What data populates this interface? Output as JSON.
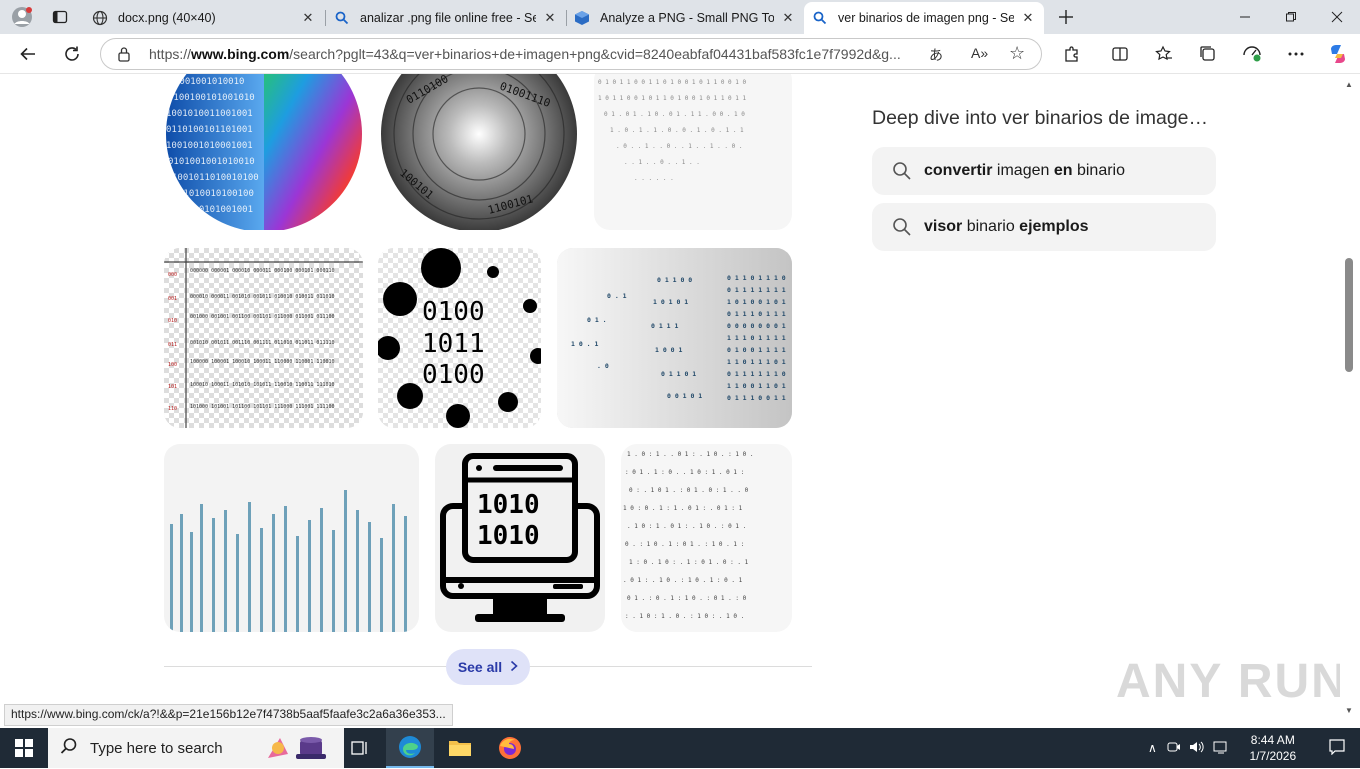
{
  "tabs": [
    {
      "title": "docx.png (40×40)",
      "icon": "globe-icon"
    },
    {
      "title": "analizar .png file online free - Sea",
      "icon": "search-icon"
    },
    {
      "title": "Analyze a PNG - Small PNG Tools",
      "icon": "cube-icon"
    },
    {
      "title": "ver binarios de imagen png - Sear",
      "icon": "search-icon",
      "active": true
    }
  ],
  "address": {
    "url_prefix": "https://",
    "url_host": "www.bing.com",
    "url_path": "/search?pglt=43&q=ver+binarios+de+imagen+png&cvid=8240eabfaf04431baf583fc1e7f7992d&g..."
  },
  "sidebar": {
    "title": "Deep dive into ver binarios de image…",
    "suggestions": [
      {
        "parts": [
          {
            "t": "convertir",
            "b": true
          },
          {
            "t": " imagen ",
            "b": false
          },
          {
            "t": "en",
            "b": true
          },
          {
            "t": " binario",
            "b": false
          }
        ]
      },
      {
        "parts": [
          {
            "t": "visor",
            "b": true
          },
          {
            "t": " binario ",
            "b": false
          },
          {
            "t": "ejemplos",
            "b": true
          }
        ]
      }
    ]
  },
  "see_all": "See all",
  "status_url": "https://www.bing.com/ck/a?!&&p=21e156b12e7f4738b5aaf5faafe3c2a6a36e353...",
  "thumb_text": {
    "circles": "0100\n1011\n0100",
    "monitor": "1010\n1010"
  },
  "watermark": "ANY RUN",
  "taskbar": {
    "search_placeholder": "Type here to search",
    "time": "8:44 AM",
    "date": "1/7/2026"
  }
}
